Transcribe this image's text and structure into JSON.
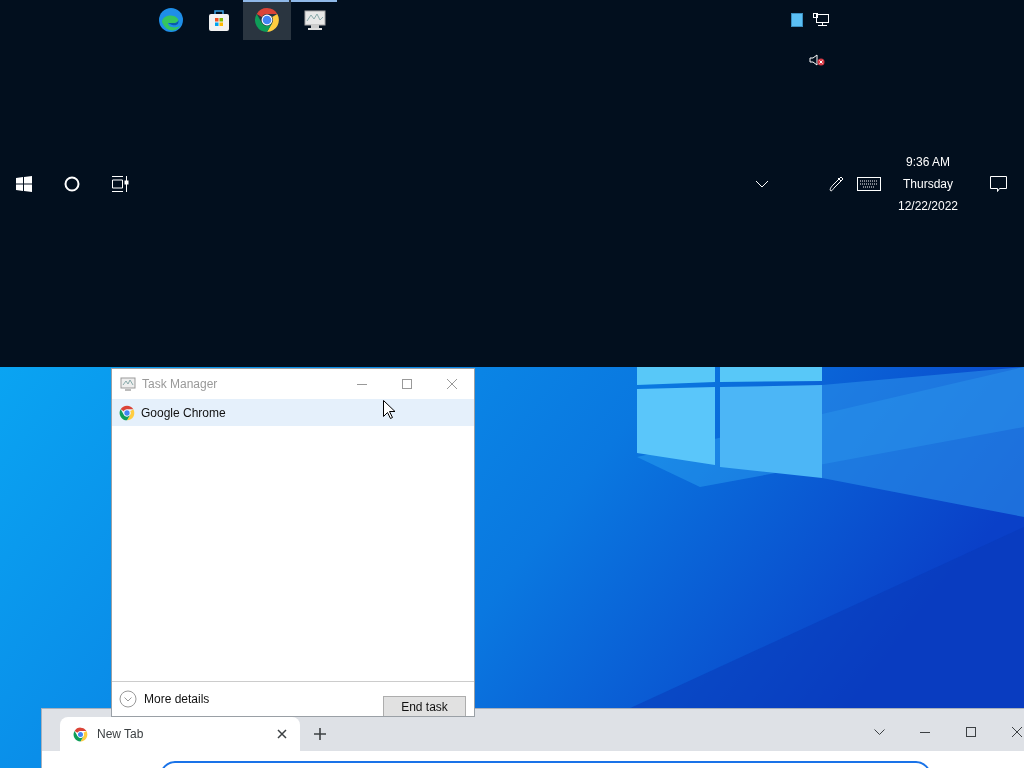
{
  "taskbar": {
    "apps": [
      {
        "kind": "edge",
        "selected": false,
        "running": false
      },
      {
        "kind": "store",
        "selected": false,
        "running": false
      },
      {
        "kind": "chrome",
        "selected": true,
        "running": true
      },
      {
        "kind": "taskmanager",
        "selected": false,
        "running": true
      }
    ],
    "volume_muted": true,
    "clock": {
      "time": "9:36 AM",
      "day": "Thursday",
      "date": "12/22/2022"
    }
  },
  "task_manager": {
    "title": "Task Manager",
    "apps": [
      {
        "name": "Google Chrome",
        "selected": true
      }
    ],
    "more_details": "More details",
    "end_task": "End task"
  },
  "chrome": {
    "tabs": [
      {
        "title": "New Tab",
        "selected": true
      }
    ]
  }
}
